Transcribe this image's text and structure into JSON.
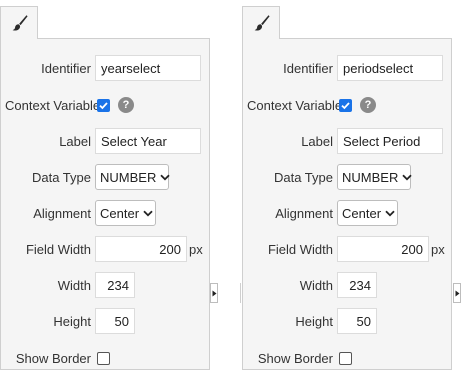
{
  "panels": [
    {
      "identifier_label": "Identifier",
      "identifier_value": "yearselect",
      "context_variable_label": "Context Variable",
      "context_variable_checked": true,
      "help_glyph": "?",
      "label_label": "Label",
      "label_value": "Select Year",
      "data_type_label": "Data Type",
      "data_type_value": "NUMBER",
      "alignment_label": "Alignment",
      "alignment_value": "Center",
      "field_width_label": "Field Width",
      "field_width_value": "200",
      "field_width_unit": "px",
      "width_label": "Width",
      "width_value": "234",
      "height_label": "Height",
      "height_value": "50",
      "show_border_label": "Show Border",
      "show_border_checked": false
    },
    {
      "identifier_label": "Identifier",
      "identifier_value": "periodselect",
      "context_variable_label": "Context Variable",
      "context_variable_checked": true,
      "help_glyph": "?",
      "label_label": "Label",
      "label_value": "Select Period",
      "data_type_label": "Data Type",
      "data_type_value": "NUMBER",
      "alignment_label": "Alignment",
      "alignment_value": "Center",
      "field_width_label": "Field Width",
      "field_width_value": "200",
      "field_width_unit": "px",
      "width_label": "Width",
      "width_value": "234",
      "height_label": "Height",
      "height_value": "50",
      "show_border_label": "Show Border",
      "show_border_checked": false
    }
  ],
  "icons": {
    "tab": "paintbrush-icon",
    "checkbox_checked": "checkmark-icon",
    "select_arrow": "chevron-down-icon",
    "collapse": "triangle-right-icon",
    "help": "help-icon"
  },
  "colors": {
    "panel_bg": "#f5f5f5",
    "border": "#cfcfcf",
    "checkbox_accent": "#1a73e8",
    "help_bg": "#8a8a8a"
  }
}
